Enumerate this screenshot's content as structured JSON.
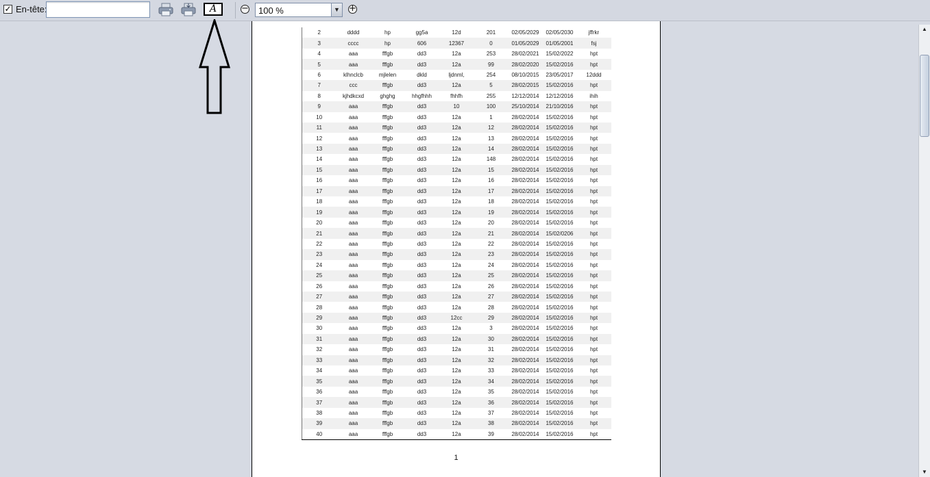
{
  "toolbar": {
    "header_checked": "✓",
    "header_label": "En-tête:",
    "header_value": "",
    "font_button_glyph": "A",
    "zoom_out_glyph": "−",
    "zoom_in_glyph": "+",
    "zoom_value": "100 %",
    "icons": [
      "print-icon",
      "print-setup-icon",
      "font-icon",
      "zoom-out-icon",
      "zoom-in-icon",
      "dropdown-arrow-icon"
    ]
  },
  "report": {
    "rows": [
      [
        "2",
        "dddd",
        "hp",
        "gg5a",
        "12d",
        "201",
        "02/05/2029",
        "02/05/2030",
        "jffrkr"
      ],
      [
        "3",
        "cccc",
        "hp",
        "606",
        "12367",
        "0",
        "01/05/2029",
        "01/05/2001",
        "fsj"
      ],
      [
        "4",
        "aaa",
        "fffgb",
        "dd3",
        "12a",
        "253",
        "28/02/2021",
        "15/02/2022",
        "hpt"
      ],
      [
        "5",
        "aaa",
        "fffgb",
        "dd3",
        "12a",
        "99",
        "28/02/2020",
        "15/02/2016",
        "hpt"
      ],
      [
        "6",
        "klhnclcb",
        "mjlelen",
        "dkld",
        "ljdnml,",
        "254",
        "08/10/2015",
        "23/05/2017",
        "12ddd"
      ],
      [
        "7",
        "ccc",
        "fffgb",
        "dd3",
        "12a",
        "5",
        "28/02/2015",
        "15/02/2016",
        "hpt"
      ],
      [
        "8",
        "kjhdkcxd",
        "ghghg",
        "hhgfhhh",
        "fhhfh",
        "255",
        "12/12/2014",
        "12/12/2016",
        "ihih"
      ],
      [
        "9",
        "aaa",
        "fffgb",
        "dd3",
        "10",
        "100",
        "25/10/2014",
        "21/10/2016",
        "hpt"
      ],
      [
        "10",
        "aaa",
        "fffgb",
        "dd3",
        "12a",
        "1",
        "28/02/2014",
        "15/02/2016",
        "hpt"
      ],
      [
        "11",
        "aaa",
        "fffgb",
        "dd3",
        "12a",
        "12",
        "28/02/2014",
        "15/02/2016",
        "hpt"
      ],
      [
        "12",
        "aaa",
        "fffgb",
        "dd3",
        "12a",
        "13",
        "28/02/2014",
        "15/02/2016",
        "hpt"
      ],
      [
        "13",
        "aaa",
        "fffgb",
        "dd3",
        "12a",
        "14",
        "28/02/2014",
        "15/02/2016",
        "hpt"
      ],
      [
        "14",
        "aaa",
        "fffgb",
        "dd3",
        "12a",
        "148",
        "28/02/2014",
        "15/02/2016",
        "hpt"
      ],
      [
        "15",
        "aaa",
        "fffgb",
        "dd3",
        "12a",
        "15",
        "28/02/2014",
        "15/02/2016",
        "hpt"
      ],
      [
        "16",
        "aaa",
        "fffgb",
        "dd3",
        "12a",
        "16",
        "28/02/2014",
        "15/02/2016",
        "hpt"
      ],
      [
        "17",
        "aaa",
        "fffgb",
        "dd3",
        "12a",
        "17",
        "28/02/2014",
        "15/02/2016",
        "hpt"
      ],
      [
        "18",
        "aaa",
        "fffgb",
        "dd3",
        "12a",
        "18",
        "28/02/2014",
        "15/02/2016",
        "hpt"
      ],
      [
        "19",
        "aaa",
        "fffgb",
        "dd3",
        "12a",
        "19",
        "28/02/2014",
        "15/02/2016",
        "hpt"
      ],
      [
        "20",
        "aaa",
        "fffgb",
        "dd3",
        "12a",
        "20",
        "28/02/2014",
        "15/02/2016",
        "hpt"
      ],
      [
        "21",
        "aaa",
        "fffgb",
        "dd3",
        "12a",
        "21",
        "28/02/2014",
        "15/02/0206",
        "hpt"
      ],
      [
        "22",
        "aaa",
        "fffgb",
        "dd3",
        "12a",
        "22",
        "28/02/2014",
        "15/02/2016",
        "hpt"
      ],
      [
        "23",
        "aaa",
        "fffgb",
        "dd3",
        "12a",
        "23",
        "28/02/2014",
        "15/02/2016",
        "hpt"
      ],
      [
        "24",
        "aaa",
        "fffgb",
        "dd3",
        "12a",
        "24",
        "28/02/2014",
        "15/02/2016",
        "hpt"
      ],
      [
        "25",
        "aaa",
        "fffgb",
        "dd3",
        "12a",
        "25",
        "28/02/2014",
        "15/02/2016",
        "hpt"
      ],
      [
        "26",
        "aaa",
        "fffgb",
        "dd3",
        "12a",
        "26",
        "28/02/2014",
        "15/02/2016",
        "hpt"
      ],
      [
        "27",
        "aaa",
        "fffgb",
        "dd3",
        "12a",
        "27",
        "28/02/2014",
        "15/02/2016",
        "hpt"
      ],
      [
        "28",
        "aaa",
        "fffgb",
        "dd3",
        "12a",
        "28",
        "28/02/2014",
        "15/02/2016",
        "hpt"
      ],
      [
        "29",
        "aaa",
        "fffgb",
        "dd3",
        "12cc",
        "29",
        "28/02/2014",
        "15/02/2016",
        "hpt"
      ],
      [
        "30",
        "aaa",
        "fffgb",
        "dd3",
        "12a",
        "3",
        "28/02/2014",
        "15/02/2016",
        "hpt"
      ],
      [
        "31",
        "aaa",
        "fffgb",
        "dd3",
        "12a",
        "30",
        "28/02/2014",
        "15/02/2016",
        "hpt"
      ],
      [
        "32",
        "aaa",
        "fffgb",
        "dd3",
        "12a",
        "31",
        "28/02/2014",
        "15/02/2016",
        "hpt"
      ],
      [
        "33",
        "aaa",
        "fffgb",
        "dd3",
        "12a",
        "32",
        "28/02/2014",
        "15/02/2016",
        "hpt"
      ],
      [
        "34",
        "aaa",
        "fffgb",
        "dd3",
        "12a",
        "33",
        "28/02/2014",
        "15/02/2016",
        "hpt"
      ],
      [
        "35",
        "aaa",
        "fffgb",
        "dd3",
        "12a",
        "34",
        "28/02/2014",
        "15/02/2016",
        "hpt"
      ],
      [
        "36",
        "aaa",
        "fffgb",
        "dd3",
        "12a",
        "35",
        "28/02/2014",
        "15/02/2016",
        "hpt"
      ],
      [
        "37",
        "aaa",
        "fffgb",
        "dd3",
        "12a",
        "36",
        "28/02/2014",
        "15/02/2016",
        "hpt"
      ],
      [
        "38",
        "aaa",
        "fffgb",
        "dd3",
        "12a",
        "37",
        "28/02/2014",
        "15/02/2016",
        "hpt"
      ],
      [
        "39",
        "aaa",
        "fffgb",
        "dd3",
        "12a",
        "38",
        "28/02/2014",
        "15/02/2016",
        "hpt"
      ],
      [
        "40",
        "aaa",
        "fffgb",
        "dd3",
        "12a",
        "39",
        "28/02/2014",
        "15/02/2016",
        "hpt"
      ]
    ],
    "page_number": "1"
  },
  "scrollbar": {
    "up_glyph": "▲",
    "down_glyph": "▼"
  }
}
